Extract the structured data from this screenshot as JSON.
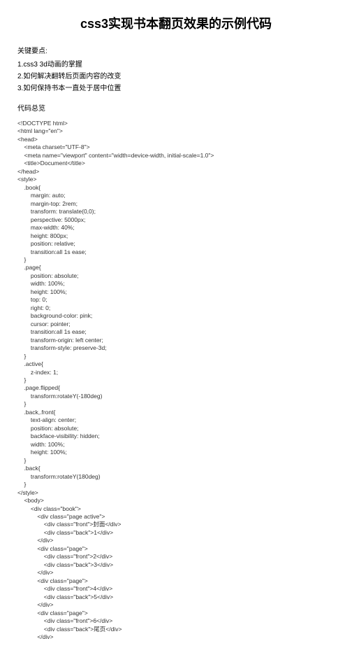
{
  "title": "css3实现书本翻页效果的示例代码",
  "keyLabel": "关键要点:",
  "points": [
    "1.css3 3d动画的掌握",
    "2.如何解决翻转后页面内容的改变",
    "3.如何保持书本一直处于居中位置"
  ],
  "codeOverview": "代码总览",
  "code": "<!DOCTYPE html>\n<html lang=\"en\">\n<head>\n    <meta charset=\"UTF-8\">\n    <meta name=\"viewport\" content=\"width=device-width, initial-scale=1.0\">\n    <title>Document</title>\n</head>\n<style>\n    .book{\n        margin: auto;\n        margin-top: 2rem;\n        transform: translate(0,0);\n        perspective: 5000px;\n        max-width: 40%;\n        height: 800px;\n        position: relative;\n        transition:all 1s ease;\n    }\n    .page{\n        position: absolute;\n        width: 100%;\n        height: 100%;\n        top: 0;\n        right: 0;\n        background-color: pink;\n        cursor: pointer;\n        transition:all 1s ease;\n        transform-origin: left center;\n        transform-style: preserve-3d;\n    }\n    .active{\n        z-index: 1;\n    }\n    .page.flipped{\n        transform:rotateY(-180deg)\n    }\n    .back,.front{\n        text-align: center;\n        position: absolute;\n        backface-visibility: hidden;\n        width: 100%;\n        height: 100%;\n    }\n    .back{\n        transform:rotateY(180deg)\n    }\n</style>\n    <body>\n        <div class=\"book\">\n            <div class=\"page active\">\n                <div class=\"front\">封面</div>\n                <div class=\"back\">1</div>\n            </div>\n            <div class=\"page\">\n                <div class=\"front\">2</div>\n                <div class=\"back\">3</div>\n            </div>\n            <div class=\"page\">\n                <div class=\"front\">4</div>\n                <div class=\"back\">5</div>\n            </div>\n            <div class=\"page\">\n                <div class=\"front\">6</div>\n                <div class=\"back\">尾页</div>\n            </div>"
}
